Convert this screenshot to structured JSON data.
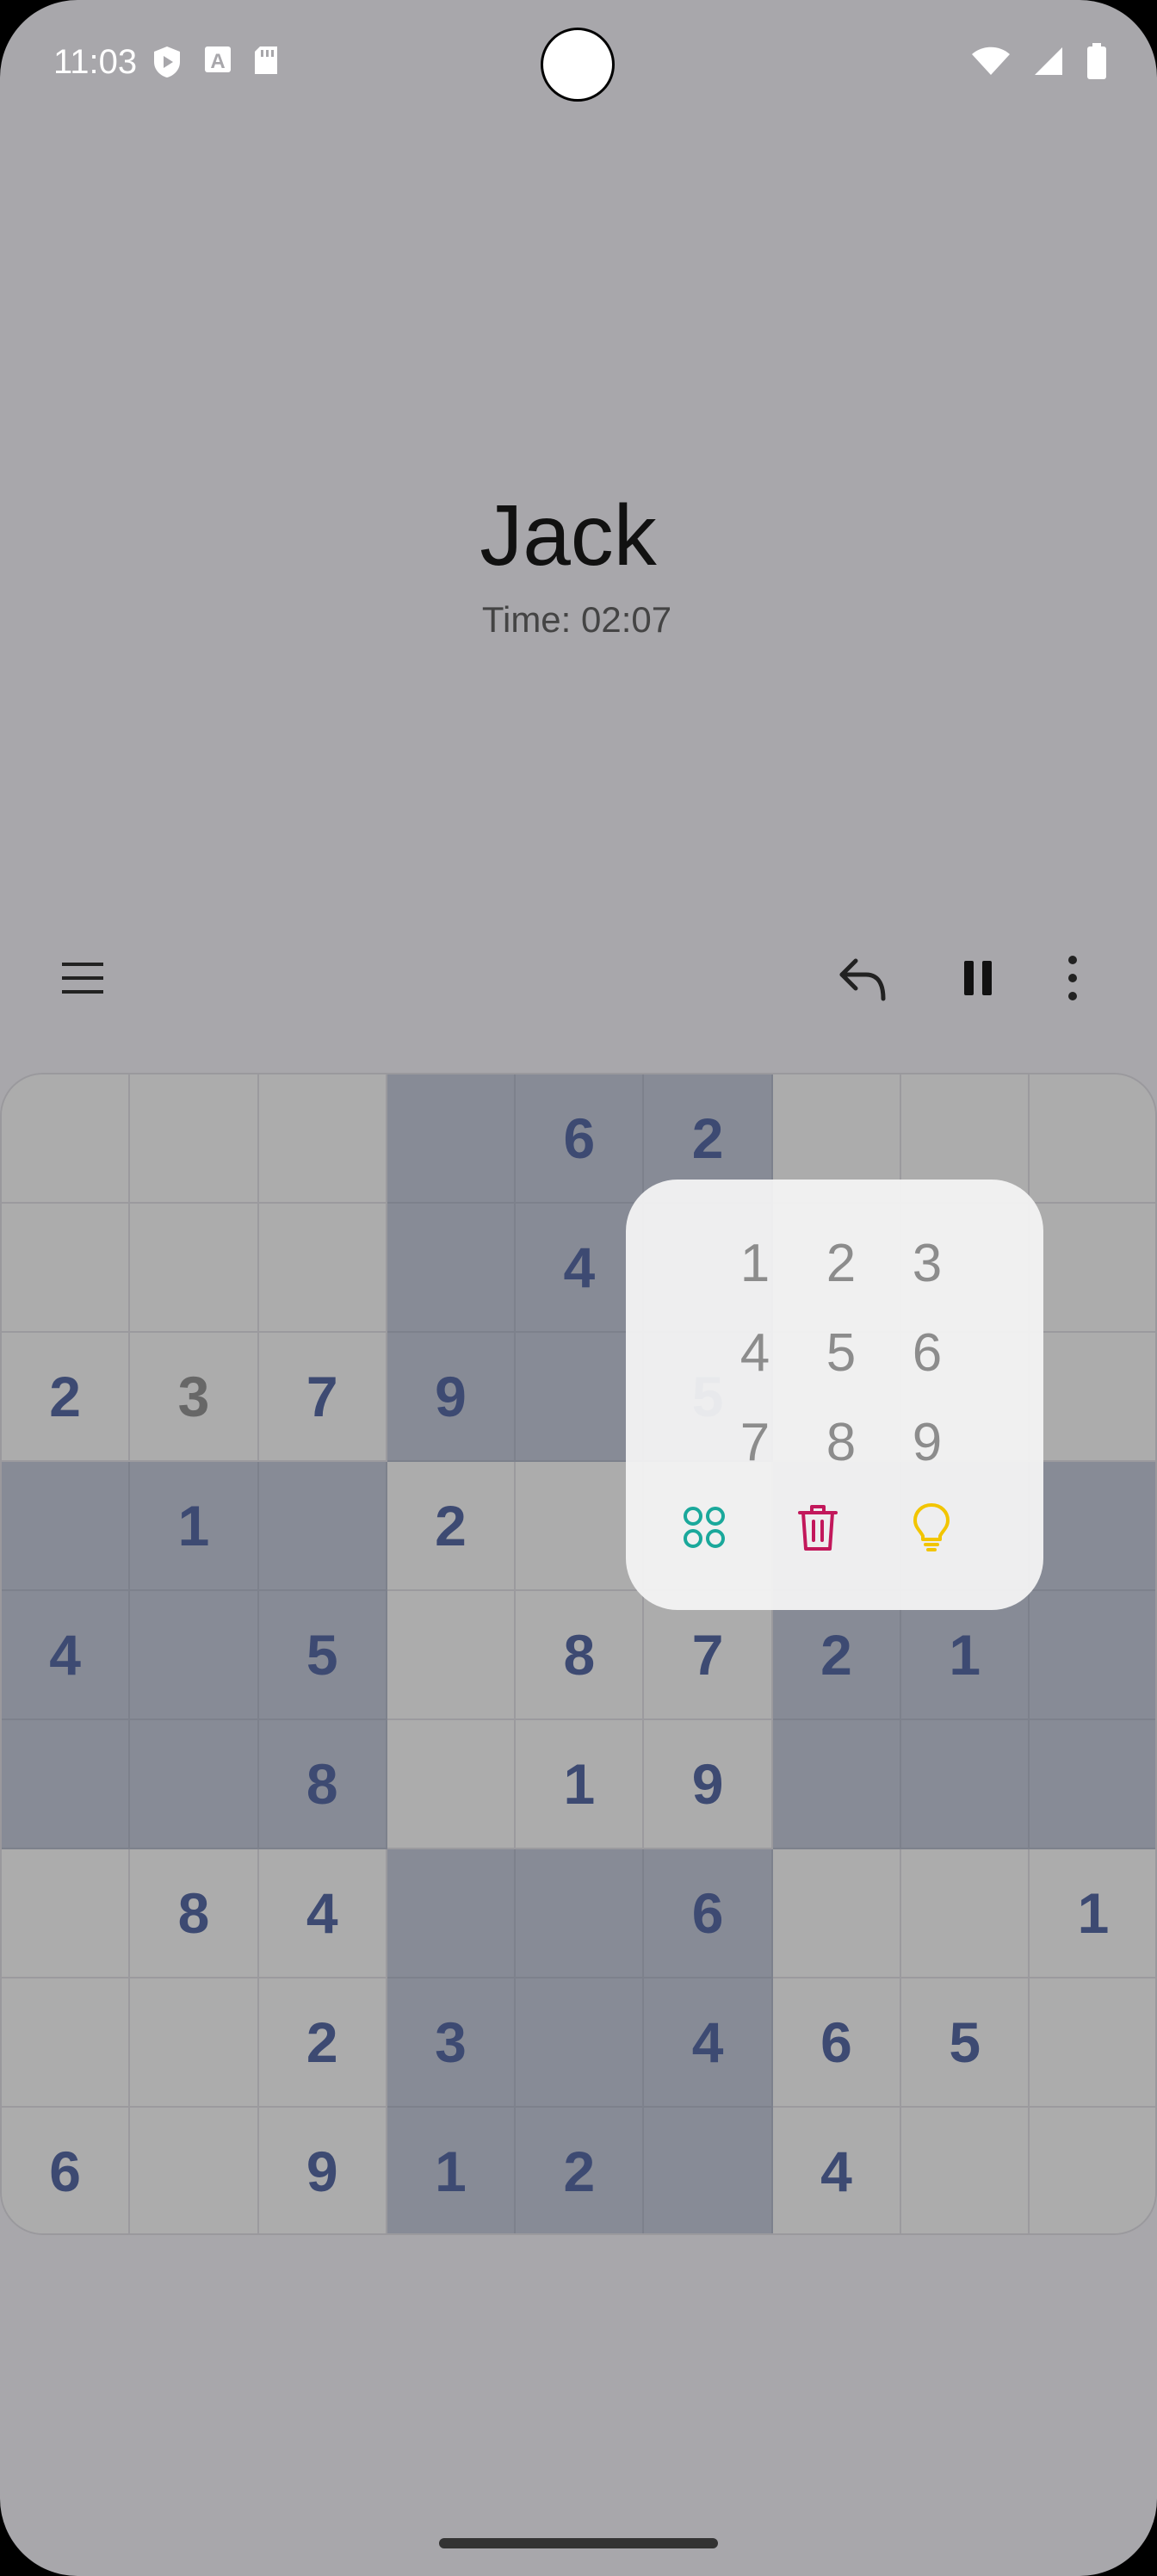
{
  "status_bar": {
    "time": "11:03"
  },
  "header": {
    "player_name": "Jack",
    "timer": "Time: 02:07"
  },
  "board": {
    "rows": [
      [
        "",
        "",
        "",
        "",
        "6",
        "2",
        "",
        "",
        ""
      ],
      [
        "",
        "",
        "",
        "",
        "4",
        "",
        "",
        "",
        ""
      ],
      [
        "2",
        "3",
        "7",
        "9",
        "",
        "5",
        "",
        "",
        ""
      ],
      [
        "",
        "1",
        "",
        "2",
        "",
        "",
        "",
        "",
        ""
      ],
      [
        "4",
        "",
        "5",
        "",
        "8",
        "7",
        "2",
        "1",
        ""
      ],
      [
        "",
        "",
        "8",
        "",
        "1",
        "9",
        "",
        "",
        ""
      ],
      [
        "",
        "8",
        "4",
        "",
        "",
        "6",
        "",
        "",
        "1"
      ],
      [
        "",
        "",
        "2",
        "3",
        "",
        "4",
        "6",
        "5",
        ""
      ],
      [
        "6",
        "",
        "9",
        "1",
        "2",
        "",
        "4",
        "",
        ""
      ]
    ],
    "shade": [
      [
        0,
        0,
        0,
        1,
        1,
        1,
        0,
        0,
        0
      ],
      [
        0,
        0,
        0,
        1,
        1,
        1,
        0,
        0,
        0
      ],
      [
        0,
        0,
        0,
        1,
        1,
        1,
        0,
        0,
        0
      ],
      [
        1,
        1,
        1,
        0,
        0,
        0,
        1,
        1,
        1
      ],
      [
        1,
        1,
        1,
        0,
        0,
        0,
        1,
        1,
        1
      ],
      [
        1,
        1,
        1,
        0,
        0,
        0,
        1,
        1,
        1
      ],
      [
        0,
        0,
        0,
        1,
        1,
        1,
        0,
        0,
        0
      ],
      [
        0,
        0,
        0,
        1,
        1,
        1,
        0,
        0,
        0
      ],
      [
        0,
        0,
        0,
        1,
        1,
        1,
        0,
        0,
        0
      ]
    ],
    "grey_digits": [
      [
        2,
        1
      ]
    ]
  },
  "number_pad": {
    "keys": [
      "1",
      "2",
      "3",
      "4",
      "5",
      "6",
      "7",
      "8",
      "9"
    ],
    "actions": [
      {
        "name": "notes",
        "icon": "four-dots-icon",
        "color": "#1aa89b"
      },
      {
        "name": "erase",
        "icon": "trash-icon",
        "color": "#c2185b"
      },
      {
        "name": "hint",
        "icon": "lightbulb-icon",
        "color": "#f2c500"
      }
    ]
  },
  "colors": {
    "digit": "#3d4a72",
    "light_cell": "#acacac",
    "dark_cell": "#878b96"
  }
}
